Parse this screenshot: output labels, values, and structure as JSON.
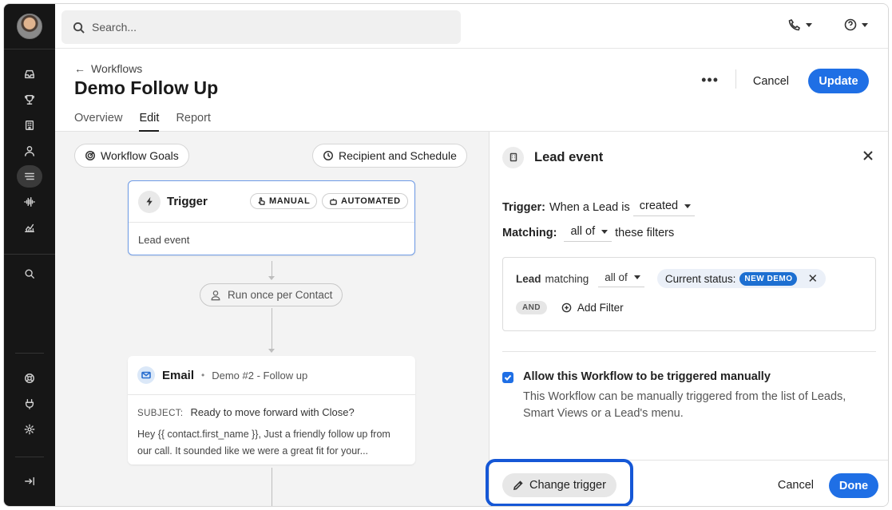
{
  "top": {
    "search_placeholder": "Search..."
  },
  "header": {
    "back_label": "Workflows",
    "title": "Demo Follow Up",
    "tabs": [
      {
        "label": "Overview"
      },
      {
        "label": "Edit"
      },
      {
        "label": "Report"
      }
    ],
    "more_label": "•••",
    "cancel_label": "Cancel",
    "update_label": "Update"
  },
  "canvas": {
    "goals_label": "Workflow Goals",
    "schedule_label": "Recipient and Schedule",
    "trigger": {
      "title": "Trigger",
      "badge_manual": "MANUAL",
      "badge_automated": "AUTOMATED",
      "subtitle": "Lead event"
    },
    "run_once_label": "Run once per Contact",
    "email": {
      "title": "Email",
      "name": "Demo #2 - Follow up",
      "subject_label": "SUBJECT:",
      "subject": "Ready to move forward with Close?",
      "preview_line1": "Hey {{ contact.first_name }}, Just a friendly follow up from",
      "preview_line2": "our call. It sounded like we were a great fit for your..."
    }
  },
  "panel": {
    "title": "Lead event",
    "trigger_label": "Trigger:",
    "trigger_text": "When a Lead is",
    "trigger_value": "created",
    "matching_label": "Matching:",
    "matching_value": "all of",
    "matching_suffix": "these filters",
    "filter": {
      "lead": "Lead",
      "matching": "matching",
      "mode": "all of",
      "chip_label": "Current status:",
      "chip_value": "NEW DEMO",
      "chip_remove": "✕",
      "and_label": "AND",
      "add_filter": "Add Filter"
    },
    "manual_checkbox": {
      "checked": true,
      "label": "Allow this Workflow to be triggered manually",
      "description": "This Workflow can be manually triggered from the list of Leads, Smart Views or a Lead's menu."
    },
    "footer": {
      "change_trigger": "Change trigger",
      "cancel": "Cancel",
      "done": "Done"
    }
  },
  "colors": {
    "accent": "#1f6fe5",
    "sidebar": "#161616",
    "highlight": "#1557d6",
    "badge": "#1d6fd1"
  }
}
